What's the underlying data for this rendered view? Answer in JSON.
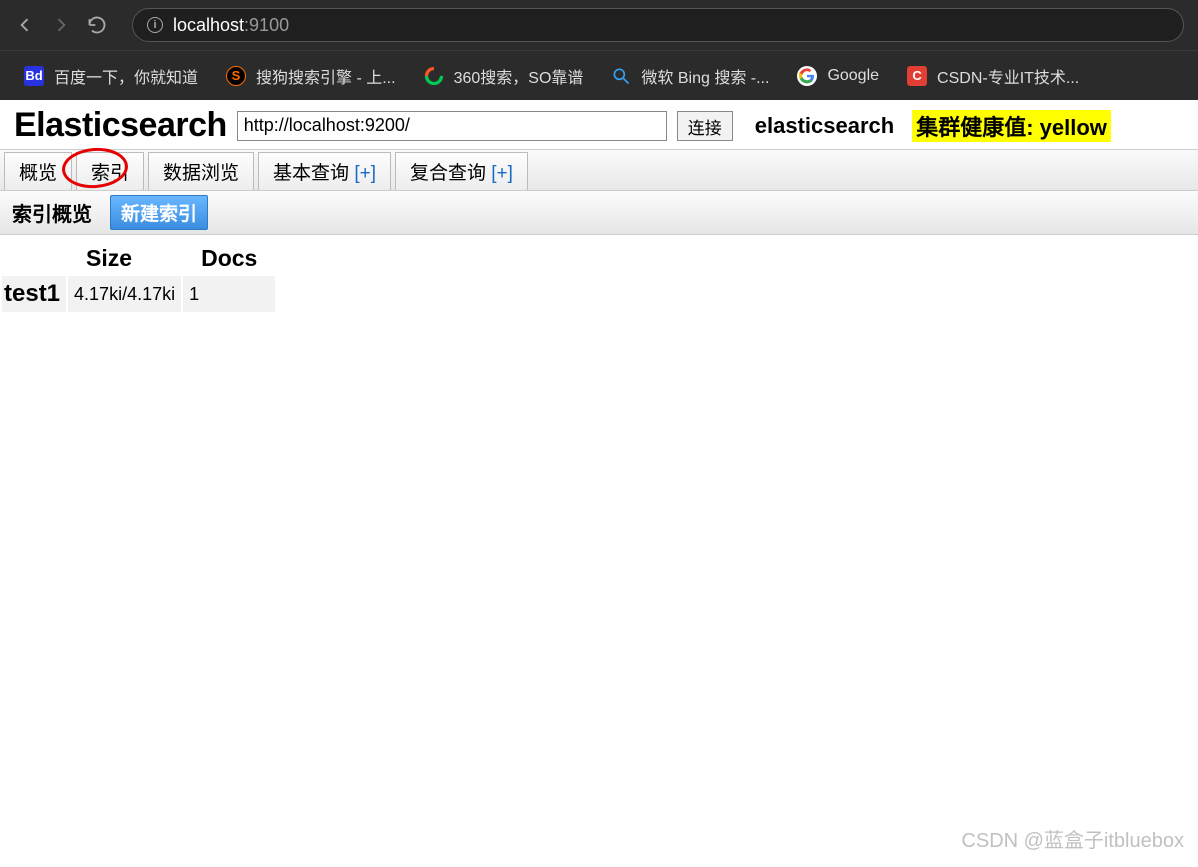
{
  "browser": {
    "url_host": "localhost",
    "url_port": ":9100"
  },
  "bookmarks": [
    {
      "label": "百度一下，你就知道",
      "icon": "baidu"
    },
    {
      "label": "搜狗搜索引擎 - 上...",
      "icon": "sogou"
    },
    {
      "label": "360搜索，SO靠谱",
      "icon": "360"
    },
    {
      "label": "微软 Bing 搜索 -...",
      "icon": "bing"
    },
    {
      "label": "Google",
      "icon": "google"
    },
    {
      "label": "CSDN-专业IT技术...",
      "icon": "csdn"
    }
  ],
  "header": {
    "logo": "Elasticsearch",
    "connect_url": "http://localhost:9200/",
    "connect_btn": "连接",
    "cluster_name": "elasticsearch",
    "cluster_health": "集群健康值: yellow"
  },
  "tabs": [
    {
      "label": "概览",
      "plus": ""
    },
    {
      "label": "索引",
      "plus": ""
    },
    {
      "label": "数据浏览",
      "plus": ""
    },
    {
      "label": "基本查询 ",
      "plus": "[+]"
    },
    {
      "label": "复合查询 ",
      "plus": "[+]"
    }
  ],
  "subheader": {
    "title": "索引概览",
    "new_index_btn": "新建索引"
  },
  "index_table": {
    "headers": [
      "",
      "Size",
      "Docs"
    ],
    "rows": [
      {
        "name": "test1",
        "size": "4.17ki/4.17ki",
        "docs": "1"
      }
    ]
  },
  "watermark": "CSDN @蓝盒子itbluebox"
}
